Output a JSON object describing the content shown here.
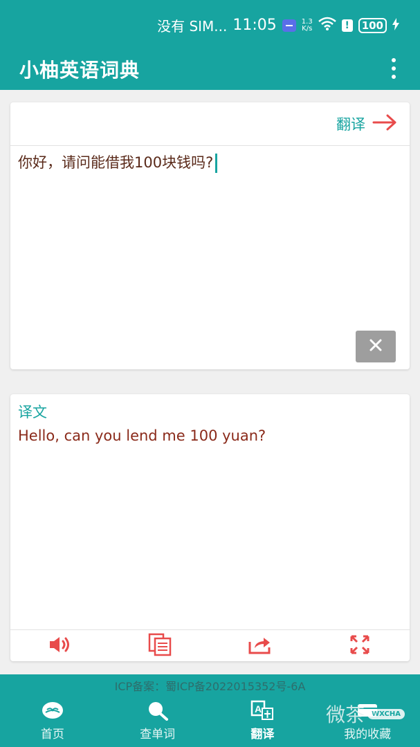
{
  "status_bar": {
    "carrier": "没有 SIM...",
    "time": "11:05",
    "speed_value": "1.3",
    "speed_unit": "K/s",
    "alert": "!",
    "battery": "100"
  },
  "app_bar": {
    "title": "小柚英语词典"
  },
  "input_card": {
    "translate_label": "翻译",
    "text": "你好，请问能借我100块钱吗?"
  },
  "output_card": {
    "label": "译文",
    "text": "Hello, can you lend me 100 yuan?"
  },
  "footer": {
    "icp": "ICP备案：蜀ICP备2022015352号-6A",
    "nav": [
      {
        "label": "首页",
        "icon": "home-book-icon"
      },
      {
        "label": "查单词",
        "icon": "search-word-icon"
      },
      {
        "label": "翻译",
        "icon": "translate-icon",
        "active": true
      },
      {
        "label": "我的收藏",
        "icon": "favorites-icon"
      }
    ]
  },
  "watermark": {
    "text": "微茶",
    "badge": "WXCHA"
  },
  "colors": {
    "primary": "#17a4a0",
    "accent_red": "#e84b4b",
    "input_text": "#5a2a1a",
    "output_text": "#8a2a1a",
    "clear_button": "#9e9e9e"
  }
}
